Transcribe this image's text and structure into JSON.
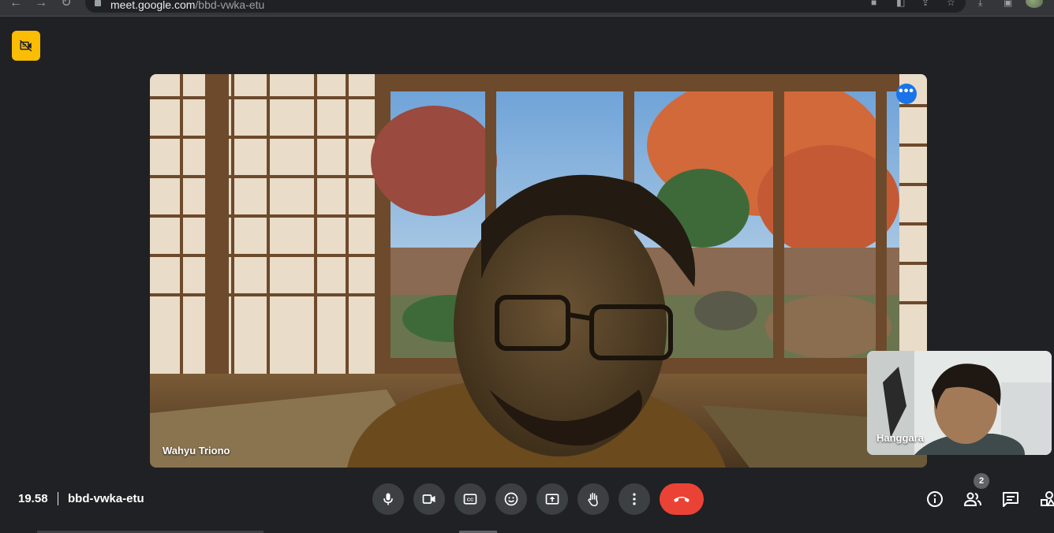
{
  "browser": {
    "url_host": "meet.google.com",
    "url_path": "/bbd-vwka-etu"
  },
  "main_video": {
    "participant_name": "Wahyu Triono"
  },
  "self_view": {
    "participant_name": "Hanggara"
  },
  "footer": {
    "time": "19.58",
    "meeting_code": "bbd-vwka-etu",
    "people_count": "2"
  },
  "icons": {
    "record": "no-video-icon",
    "mic": "mic-icon",
    "camera": "videocam-icon",
    "captions": "closed-captions-icon",
    "emoji": "emoji-icon",
    "present": "present-screen-icon",
    "raise_hand": "raise-hand-icon",
    "more": "more-vert-icon",
    "end_call": "call-end-icon",
    "info": "info-icon",
    "people": "people-icon",
    "chat": "chat-icon",
    "activities": "activities-icon"
  },
  "colors": {
    "background": "#202124",
    "control_bg": "#3c4043",
    "end_call": "#ea4335",
    "badge_yellow": "#fbbc04",
    "accent_blue": "#1a73e8"
  }
}
